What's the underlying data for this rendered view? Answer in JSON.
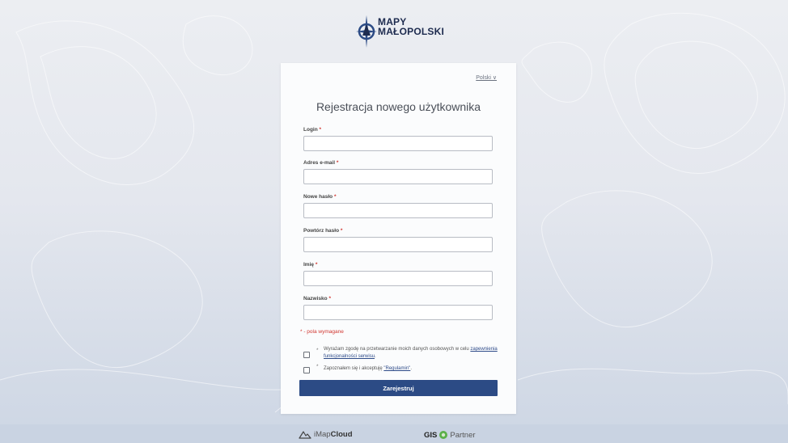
{
  "brand": {
    "line1": "MAPY",
    "line2": "MAŁOPOLSKI"
  },
  "language": {
    "label": "Polski ∨"
  },
  "form": {
    "title": "Rejestracja nowego użytkownika",
    "fields": [
      {
        "label": "Login",
        "value": "",
        "placeholder": ""
      },
      {
        "label": "Adres e-mail",
        "value": "",
        "placeholder": ""
      },
      {
        "label": "Nowe hasło",
        "value": "",
        "placeholder": ""
      },
      {
        "label": "Powtórz hasło",
        "value": "",
        "placeholder": ""
      },
      {
        "label": "Imię",
        "value": "",
        "placeholder": ""
      },
      {
        "label": "Nazwisko",
        "value": "",
        "placeholder": ""
      }
    ],
    "required_star": "*",
    "required_note": "* - pola wymagane",
    "consent1": {
      "text": "Wyrażam zgodę na przetwarzanie moich danych osobowych w celu ",
      "link": "zapewnienia funkcjonalności serwisu",
      "suffix": "."
    },
    "consent2": {
      "text": "Zapoznałem się i akceptuję ",
      "link": "\"Regulamin\"",
      "suffix": "."
    },
    "submit_label": "Zarejestruj"
  },
  "footer": {
    "imap_prefix": "iMap",
    "imap_bold": "Cloud",
    "gis_bold": "GIS",
    "gis_rest": "Partner"
  },
  "colors": {
    "accent": "#2c4b85",
    "required": "#d0352f",
    "brand": "#1d2b4f"
  }
}
